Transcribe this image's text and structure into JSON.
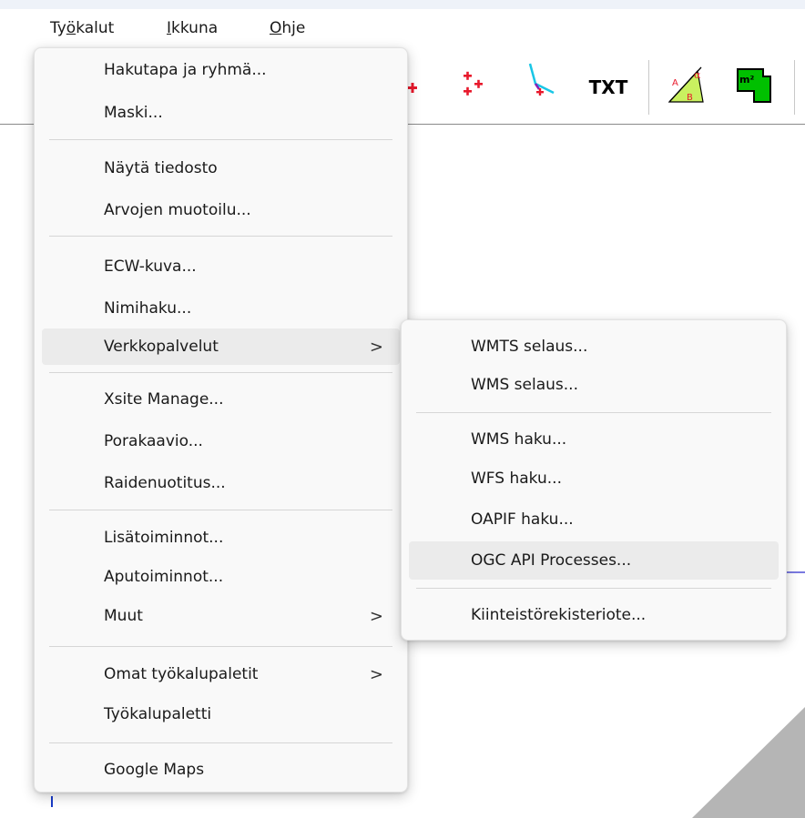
{
  "menubar": {
    "tyokalut_pre": "Ty",
    "tyokalut_mn": "ö",
    "tyokalut_post": "kalut",
    "ikkuna_mn": "I",
    "ikkuna_post": "kkuna",
    "ohje_mn": "O",
    "ohje_post": "hje"
  },
  "toolbar": {
    "txt_label": "TXT",
    "area_label": "m²"
  },
  "main_menu": {
    "items": [
      {
        "label": "Hakutapa ja ryhmä...",
        "has_submenu": false
      },
      {
        "label": "Maski...",
        "has_submenu": false
      },
      {
        "label": "Näytä tiedosto",
        "has_submenu": false
      },
      {
        "label": "Arvojen muotoilu...",
        "has_submenu": false
      },
      {
        "label": "ECW-kuva...",
        "has_submenu": false
      },
      {
        "label": "Nimihaku...",
        "has_submenu": false
      },
      {
        "label": "Verkkopalvelut",
        "has_submenu": true,
        "highlighted": true
      },
      {
        "label": "Xsite Manage...",
        "has_submenu": false
      },
      {
        "label": "Porakaavio...",
        "has_submenu": false
      },
      {
        "label": "Raidenuotitus...",
        "has_submenu": false
      },
      {
        "label": "Lisätoiminnot...",
        "has_submenu": false
      },
      {
        "label": "Aputoiminnot...",
        "has_submenu": false
      },
      {
        "label": "Muut",
        "has_submenu": true
      },
      {
        "label": "Omat työkalupaletit",
        "has_submenu": true
      },
      {
        "label": "Työkalupaletti",
        "has_submenu": false
      },
      {
        "label": "Google Maps",
        "has_submenu": false
      }
    ],
    "submenu_arrow": ">"
  },
  "sub_menu": {
    "items": [
      {
        "label": "WMTS selaus..."
      },
      {
        "label": "WMS selaus..."
      },
      {
        "label": "WMS haku..."
      },
      {
        "label": "WFS haku..."
      },
      {
        "label": "OAPIF haku..."
      },
      {
        "label": "OGC API Processes...",
        "highlighted": true
      },
      {
        "label": "Kiinteistörekisteriote..."
      }
    ]
  },
  "colors": {
    "accent_red": "#e8192c",
    "accent_blue": "#1a73e8",
    "line_cyan": "#19c6e6",
    "area_green": "#00c000",
    "menu_bg": "#f9f9f9",
    "highlight": "#ebebeb"
  }
}
